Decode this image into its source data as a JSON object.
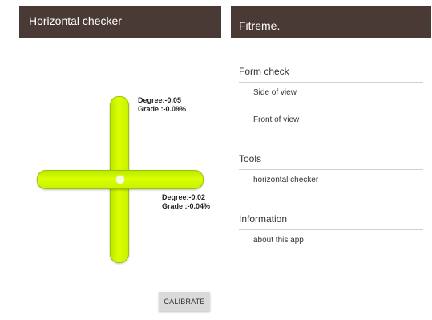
{
  "left_screen": {
    "title": "Horizontal checker",
    "vertical_reading": {
      "degree": "Degree:-0.05",
      "grade": "Grade :-0.09%"
    },
    "horizontal_reading": {
      "degree": "Degree:-0.02",
      "grade": "Grade :-0.04%"
    },
    "calibrate_label": "CALIBRATE"
  },
  "right_screen": {
    "title": "Fitreme.",
    "sections": [
      {
        "header": "Form check",
        "items": [
          "Side of view",
          "Front of view"
        ]
      },
      {
        "header": "Tools",
        "items": [
          "horizontal checker"
        ]
      },
      {
        "header": "Information",
        "items": [
          "about this app"
        ]
      }
    ]
  },
  "colors": {
    "appbar": "#4a3a36",
    "level_bar": "#dcff00",
    "button": "#dadada"
  }
}
